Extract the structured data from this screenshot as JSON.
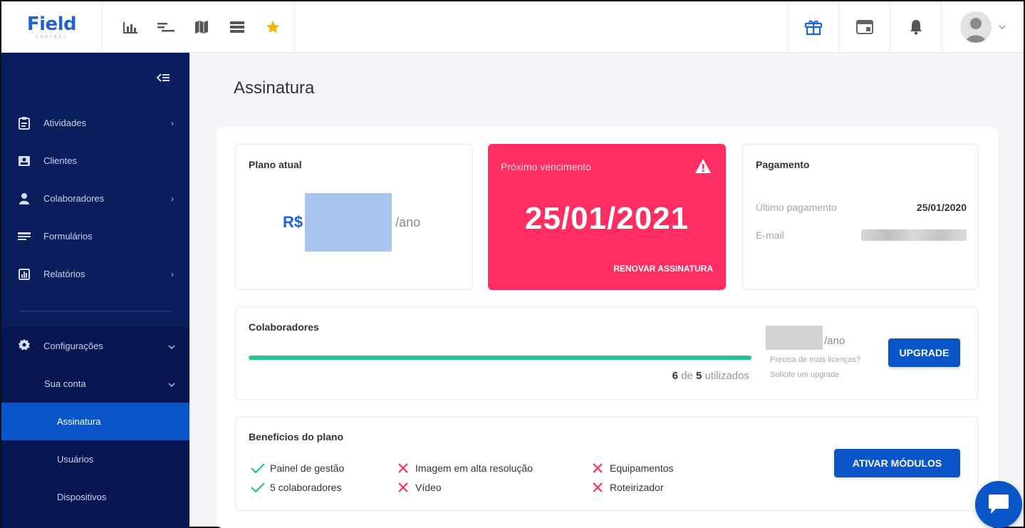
{
  "app": {
    "logo_text": "Field",
    "logo_sub": "CONTROL"
  },
  "topbar": {
    "tools": [
      "bar-chart-icon",
      "gantt-icon",
      "map-icon",
      "list-icon",
      "star-icon"
    ],
    "right": [
      "gift-icon",
      "calendar-window-icon",
      "bell-icon"
    ]
  },
  "sidebar": {
    "items": [
      {
        "label": "Atividades",
        "icon": "clipboard-icon",
        "has_chevron": true
      },
      {
        "label": "Clientes",
        "icon": "contact-card-icon",
        "has_chevron": false
      },
      {
        "label": "Colaboradores",
        "icon": "user-icon",
        "has_chevron": true
      },
      {
        "label": "Formulários",
        "icon": "form-icon",
        "has_chevron": false
      },
      {
        "label": "Relatórios",
        "icon": "report-icon",
        "has_chevron": true
      }
    ],
    "settings": {
      "label": "Configurações",
      "icon": "gear-icon"
    },
    "account": {
      "label": "Sua conta"
    },
    "sub_items": [
      {
        "label": "Assinatura",
        "active": true
      },
      {
        "label": "Usuários",
        "active": false
      },
      {
        "label": "Dispositivos",
        "active": false
      }
    ]
  },
  "page": {
    "title": "Assinatura"
  },
  "plan": {
    "title": "Plano atual",
    "currency": "R$",
    "period": "/ano"
  },
  "due": {
    "label": "Próximo vencimento",
    "date": "25/01/2021",
    "renew_label": "RENOVAR ASSINATURA",
    "color": "#ff2e62"
  },
  "payment": {
    "title": "Pagamento",
    "last_label": "Último pagamento",
    "last_value": "25/01/2020",
    "email_label": "E-mail"
  },
  "collaborators": {
    "title": "Colaboradores",
    "used": "6",
    "of_text": "de",
    "total": "5",
    "used_suffix": "utilizados",
    "progress_fraction": 1.0,
    "period": "/ano",
    "help_line1": "Precisa de mais licenças?",
    "help_line2": "Solicite um upgrade",
    "upgrade_label": "UPGRADE"
  },
  "benefits": {
    "title": "Benefícios do plano",
    "items": [
      {
        "label": "Painel de gestão",
        "included": true
      },
      {
        "label": "5 colaboradores",
        "included": true
      },
      {
        "label": "Imagem em alta resolução",
        "included": false
      },
      {
        "label": "Vídeo",
        "included": false
      },
      {
        "label": "Equipamentos",
        "included": false
      },
      {
        "label": "Roteirizador",
        "included": false
      }
    ],
    "activate_label": "ATIVAR MÓDULOS"
  },
  "colors": {
    "primary": "#0a55c8",
    "sidebar": "#0a1d5c",
    "success": "#27c28a",
    "danger": "#ff2e62"
  }
}
